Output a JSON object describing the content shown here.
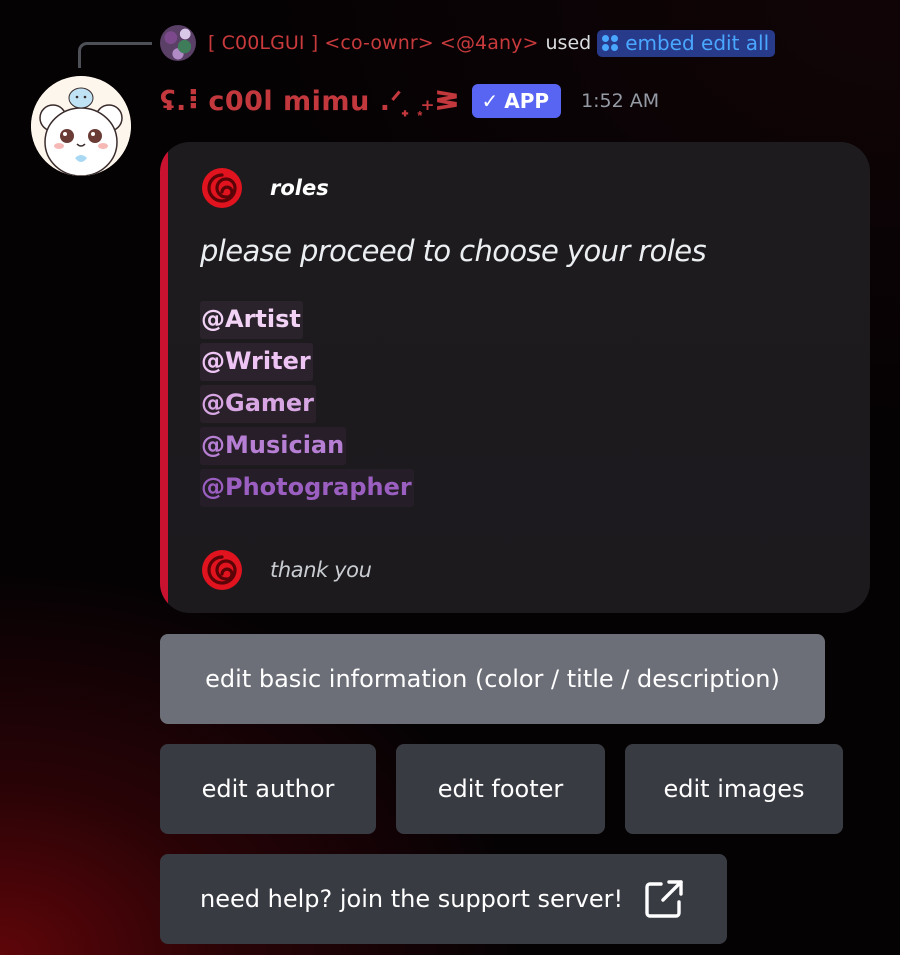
{
  "reply": {
    "user": "[ C00LGUI ] <co-ownr> <@4any>",
    "used_text": "used",
    "command_icon": "slash-command-icon",
    "command": "embed edit all"
  },
  "message": {
    "author_avatar_icon": "bear-avatar-icon",
    "author": "ʢ.⠇c00l mimu .ᐟ ̟ ͙₊ᕒ",
    "badge": "APP",
    "badge_icon": "checkmark-icon",
    "timestamp": "1:52 AM"
  },
  "embed": {
    "accent_color": "#c9122f",
    "author_icon": "red-swirl-icon",
    "author_name": "roles",
    "title": "please proceed to choose your roles",
    "roles": [
      {
        "label": "@Artist",
        "color": "#f2d3f5",
        "bg": "#2b232c"
      },
      {
        "label": "@Writer",
        "color": "#eec4f4",
        "bg": "#2c222d"
      },
      {
        "label": "@Gamer",
        "color": "#d7a6e3",
        "bg": "#2a2029"
      },
      {
        "label": "@Musician",
        "color": "#b67fd3",
        "bg": "#271e29"
      },
      {
        "label": "@Photographer",
        "color": "#9b5fc2",
        "bg": "#251d27"
      }
    ],
    "divider_icon": "red-wave-divider",
    "footer_icon": "red-swirl-icon",
    "footer_text": "thank you"
  },
  "buttons": {
    "basic_info": "edit basic information (color / title / description)",
    "author": "edit author",
    "footer": "edit footer",
    "images": "edit images",
    "support": "need help? join the support server!",
    "support_icon": "external-link-icon"
  }
}
